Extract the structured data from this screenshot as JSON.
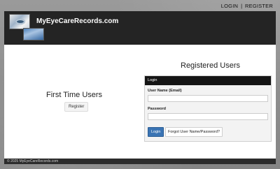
{
  "topnav": {
    "login_label": "LOGIN",
    "separator": "|",
    "register_label": "REGISTER"
  },
  "header": {
    "site_title": "MyEyeCareRecords.com"
  },
  "first_time": {
    "title": "First Time Users",
    "register_button": "Register"
  },
  "registered": {
    "title": "Registered Users",
    "panel_title": "Login",
    "username_label": "User Name (Email)",
    "username_value": "",
    "password_label": "Password",
    "password_value": "",
    "login_button": "Login",
    "forgot_button": "Forgot User Name/Password?"
  },
  "footer": {
    "text": "© 2025 MyEyeCareRecords.com"
  },
  "colors": {
    "header_bg": "#242424",
    "login_button_bg": "#3a74b4",
    "page_bg": "#8f8f8f"
  }
}
